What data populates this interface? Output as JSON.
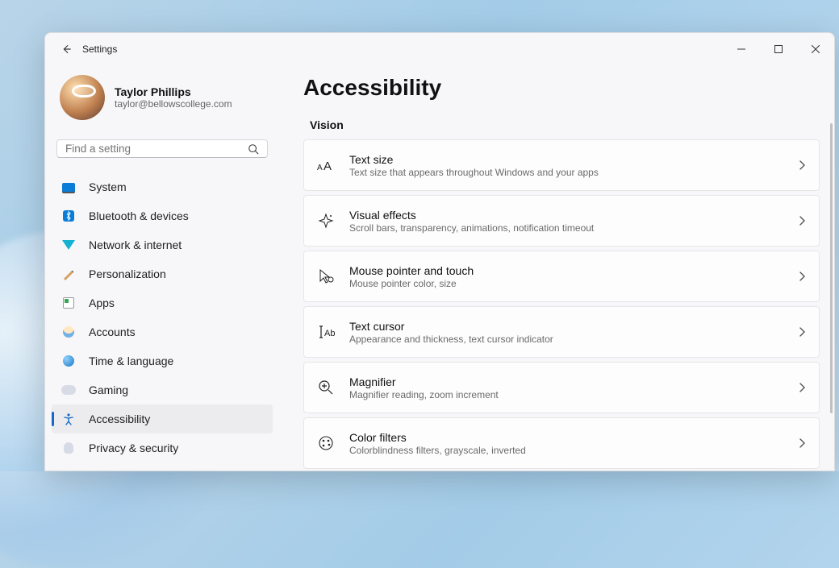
{
  "window": {
    "title": "Settings"
  },
  "profile": {
    "name": "Taylor Phillips",
    "email": "taylor@bellowscollege.com"
  },
  "search": {
    "placeholder": "Find a setting"
  },
  "sidebar": {
    "items": [
      {
        "label": "System"
      },
      {
        "label": "Bluetooth & devices"
      },
      {
        "label": "Network & internet"
      },
      {
        "label": "Personalization"
      },
      {
        "label": "Apps"
      },
      {
        "label": "Accounts"
      },
      {
        "label": "Time & language"
      },
      {
        "label": "Gaming"
      },
      {
        "label": "Accessibility"
      },
      {
        "label": "Privacy & security"
      }
    ],
    "active_index": 8
  },
  "page": {
    "title": "Accessibility"
  },
  "section": {
    "title": "Vision"
  },
  "cards": [
    {
      "title": "Text size",
      "sub": "Text size that appears throughout Windows and your apps"
    },
    {
      "title": "Visual effects",
      "sub": "Scroll bars, transparency, animations, notification timeout"
    },
    {
      "title": "Mouse pointer and touch",
      "sub": "Mouse pointer color, size"
    },
    {
      "title": "Text cursor",
      "sub": "Appearance and thickness, text cursor indicator"
    },
    {
      "title": "Magnifier",
      "sub": "Magnifier reading, zoom increment"
    },
    {
      "title": "Color filters",
      "sub": "Colorblindness filters, grayscale, inverted"
    }
  ]
}
